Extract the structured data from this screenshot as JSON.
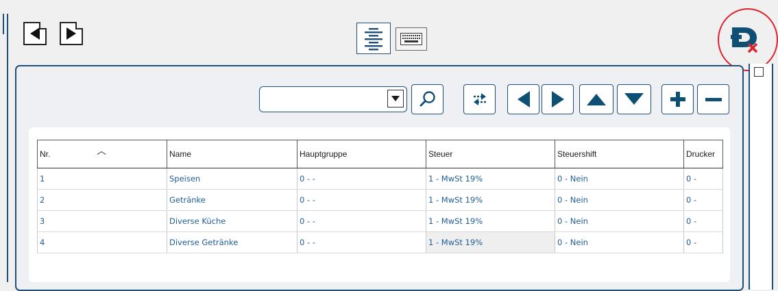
{
  "toolbar": {
    "prev_page": "previous-page",
    "next_page": "next-page",
    "view_list": "list-view",
    "view_keyboard": "keyboard-view",
    "exit": "exit-record"
  },
  "filter": {
    "combo_value": "",
    "search": "search",
    "swap": "swap",
    "nav": [
      "first-left",
      "right",
      "up",
      "down"
    ],
    "add": "add",
    "remove": "remove"
  },
  "table": {
    "columns": [
      "Nr.",
      "Name",
      "Hauptgruppe",
      "Steuer",
      "Steuershift",
      "Drucker"
    ],
    "sort_column": "Nr.",
    "rows": [
      [
        "1",
        "Speisen",
        "0 - -",
        "1 - MwSt 19%",
        "0 - Nein",
        "0 -"
      ],
      [
        "2",
        "Getränke",
        "0 - -",
        "1 - MwSt 19%",
        "0 - Nein",
        "0 -"
      ],
      [
        "3",
        "Diverse Küche",
        "0 - -",
        "1 - MwSt 19%",
        "0 - Nein",
        "0 -"
      ],
      [
        "4",
        "Diverse Getränke",
        "0 - -",
        "1 - MwSt 19%",
        "0 - Nein",
        "0 -"
      ]
    ],
    "selected_cell": [
      3,
      3
    ]
  },
  "colors": {
    "accent": "#1f4e79",
    "icon": "#0e4f73",
    "annotation": "#e0202a",
    "link_text": "#1f5d99"
  }
}
